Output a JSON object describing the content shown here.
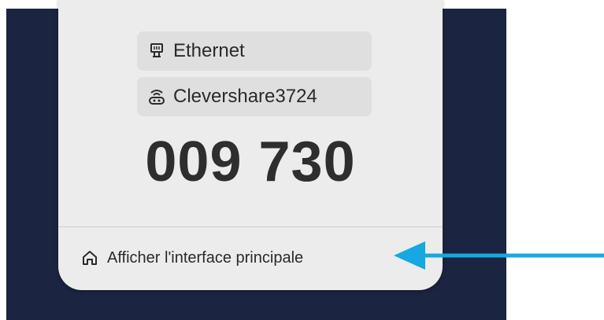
{
  "card": {
    "connection_label": "Ethernet",
    "connection_icon": "ethernet-icon",
    "network_name": "Clevershare3724",
    "network_icon": "router-icon",
    "pairing_code": "009 730",
    "home_action_label": "Afficher l'interface principale",
    "home_action_icon": "home-icon"
  },
  "annotation": {
    "arrow_color": "#16a8e0",
    "arrow_direction": "left"
  },
  "colors": {
    "background": "#1b2440",
    "card": "#ececec",
    "chip": "#dfdfdf"
  }
}
